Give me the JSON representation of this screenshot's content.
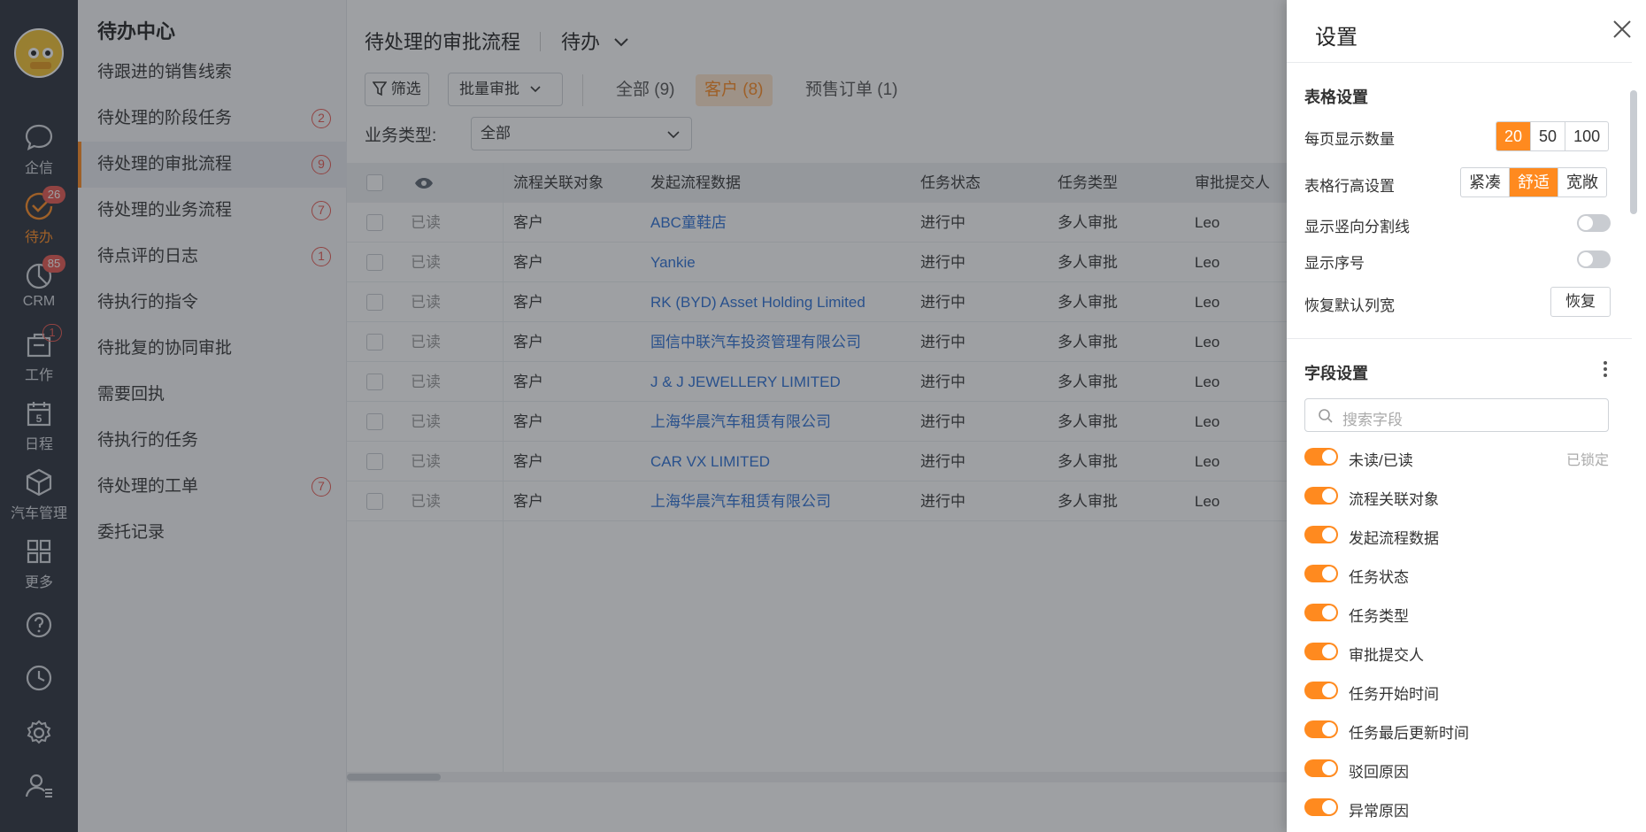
{
  "nav": {
    "items": [
      {
        "label": "企信",
        "icon": "chat-icon",
        "badge": ""
      },
      {
        "label": "待办",
        "icon": "check-circle-icon",
        "badge": "26"
      },
      {
        "label": "CRM",
        "icon": "pie-chart-icon",
        "badge": "85"
      },
      {
        "label": "工作",
        "icon": "briefcase-icon",
        "badge": "1"
      },
      {
        "label": "日程",
        "icon": "calendar-icon",
        "badge": ""
      },
      {
        "label": "汽车管理",
        "icon": "cube-icon",
        "badge": ""
      },
      {
        "label": "更多",
        "icon": "grid-icon",
        "badge": ""
      }
    ],
    "calendar_day": "5",
    "accent": "#ff8a1f"
  },
  "submenu": {
    "title": "待办中心",
    "items": [
      {
        "label": "待跟进的销售线索",
        "count": ""
      },
      {
        "label": "待处理的阶段任务",
        "count": "2"
      },
      {
        "label": "待处理的审批流程",
        "count": "9"
      },
      {
        "label": "待处理的业务流程",
        "count": "7"
      },
      {
        "label": "待点评的日志",
        "count": "1"
      },
      {
        "label": "待执行的指令",
        "count": ""
      },
      {
        "label": "待批复的协同审批",
        "count": ""
      },
      {
        "label": "需要回执",
        "count": ""
      },
      {
        "label": "待执行的任务",
        "count": ""
      },
      {
        "label": "待处理的工单",
        "count": "7"
      },
      {
        "label": "委托记录",
        "count": ""
      }
    ]
  },
  "main": {
    "title": "待处理的审批流程",
    "view": "待办",
    "filter_label": "筛选",
    "batch_label": "批量审批",
    "tabs": [
      "全部 (9)",
      "客户 (8)",
      "预售订单 (1)"
    ],
    "biz_type_label": "业务类型:",
    "biz_type_value": "全部",
    "columns": [
      "流程关联对象",
      "发起流程数据",
      "任务状态",
      "任务类型",
      "审批提交人"
    ],
    "rows": [
      {
        "read": "已读",
        "object": "客户",
        "data": "ABC童鞋店",
        "status": "进行中",
        "type": "多人审批",
        "submitter": "Leo"
      },
      {
        "read": "已读",
        "object": "客户",
        "data": "Yankie",
        "status": "进行中",
        "type": "多人审批",
        "submitter": "Leo"
      },
      {
        "read": "已读",
        "object": "客户",
        "data": "RK (BYD) Asset Holding Limited",
        "status": "进行中",
        "type": "多人审批",
        "submitter": "Leo"
      },
      {
        "read": "已读",
        "object": "客户",
        "data": "国信中联汽车投资管理有限公司",
        "status": "进行中",
        "type": "多人审批",
        "submitter": "Leo"
      },
      {
        "read": "已读",
        "object": "客户",
        "data": "J & J JEWELLERY LIMITED",
        "status": "进行中",
        "type": "多人审批",
        "submitter": "Leo"
      },
      {
        "read": "已读",
        "object": "客户",
        "data": "上海华晨汽车租赁有限公司",
        "status": "进行中",
        "type": "多人审批",
        "submitter": "Leo"
      },
      {
        "read": "已读",
        "object": "客户",
        "data": "CAR VX LIMITED",
        "status": "进行中",
        "type": "多人审批",
        "submitter": "Leo"
      },
      {
        "read": "已读",
        "object": "客户",
        "data": "上海华晨汽车租赁有限公司",
        "status": "进行中",
        "type": "多人审批",
        "submitter": "Leo"
      }
    ]
  },
  "drawer": {
    "title": "设置",
    "table_section": "表格设置",
    "page_size_label": "每页显示数量",
    "page_sizes": [
      "20",
      "50",
      "100"
    ],
    "row_height_label": "表格行高设置",
    "row_heights": [
      "紧凑",
      "舒适",
      "宽敞"
    ],
    "vertical_lines_label": "显示竖向分割线",
    "show_index_label": "显示序号",
    "reset_width_label": "恢复默认列宽",
    "reset_button": "恢复",
    "field_section": "字段设置",
    "search_placeholder": "搜索字段",
    "locked_label": "已锁定",
    "fields": [
      "未读/已读",
      "流程关联对象",
      "发起流程数据",
      "任务状态",
      "任务类型",
      "审批提交人",
      "任务开始时间",
      "任务最后更新时间",
      "驳回原因",
      "异常原因"
    ]
  }
}
